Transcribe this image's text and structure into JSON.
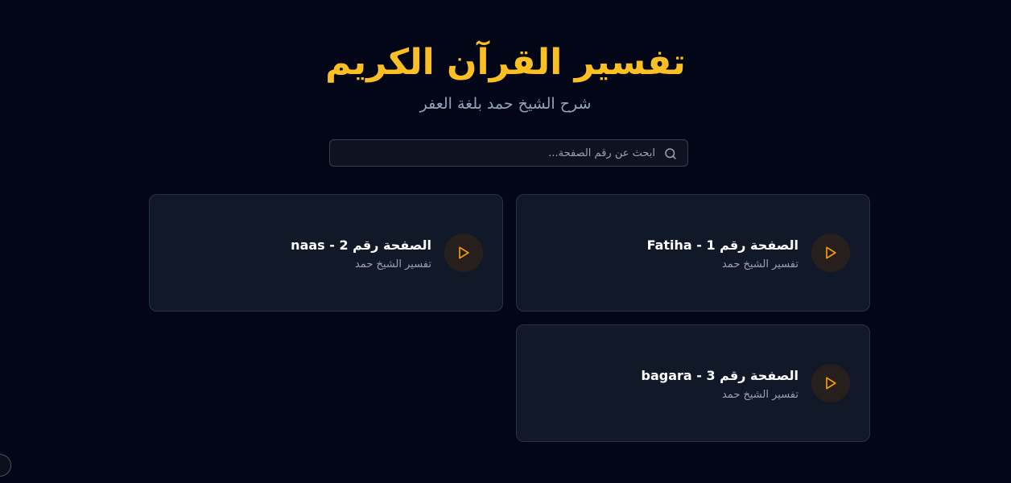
{
  "header": {
    "title": "تفسير القرآن الكريم",
    "subtitle": "شرح الشيخ حمد بلغة العفر"
  },
  "search": {
    "placeholder": "ابحث عن رقم الصفحة...",
    "value": "",
    "icon": "search-icon"
  },
  "colors": {
    "background": "#020617",
    "accent": "#fbbf24",
    "card_background": "#111827",
    "play_icon": "#f59e0b"
  },
  "cards": [
    {
      "title": "الصفحة رقم 1 - Fatiha",
      "subtitle": "تفسير الشيخ حمد",
      "icon": "play-icon"
    },
    {
      "title": "الصفحة رقم 2 - naas",
      "subtitle": "تفسير الشيخ حمد",
      "icon": "play-icon"
    },
    {
      "title": "الصفحة رقم 3 - bagara",
      "subtitle": "تفسير الشيخ حمد",
      "icon": "play-icon"
    }
  ]
}
